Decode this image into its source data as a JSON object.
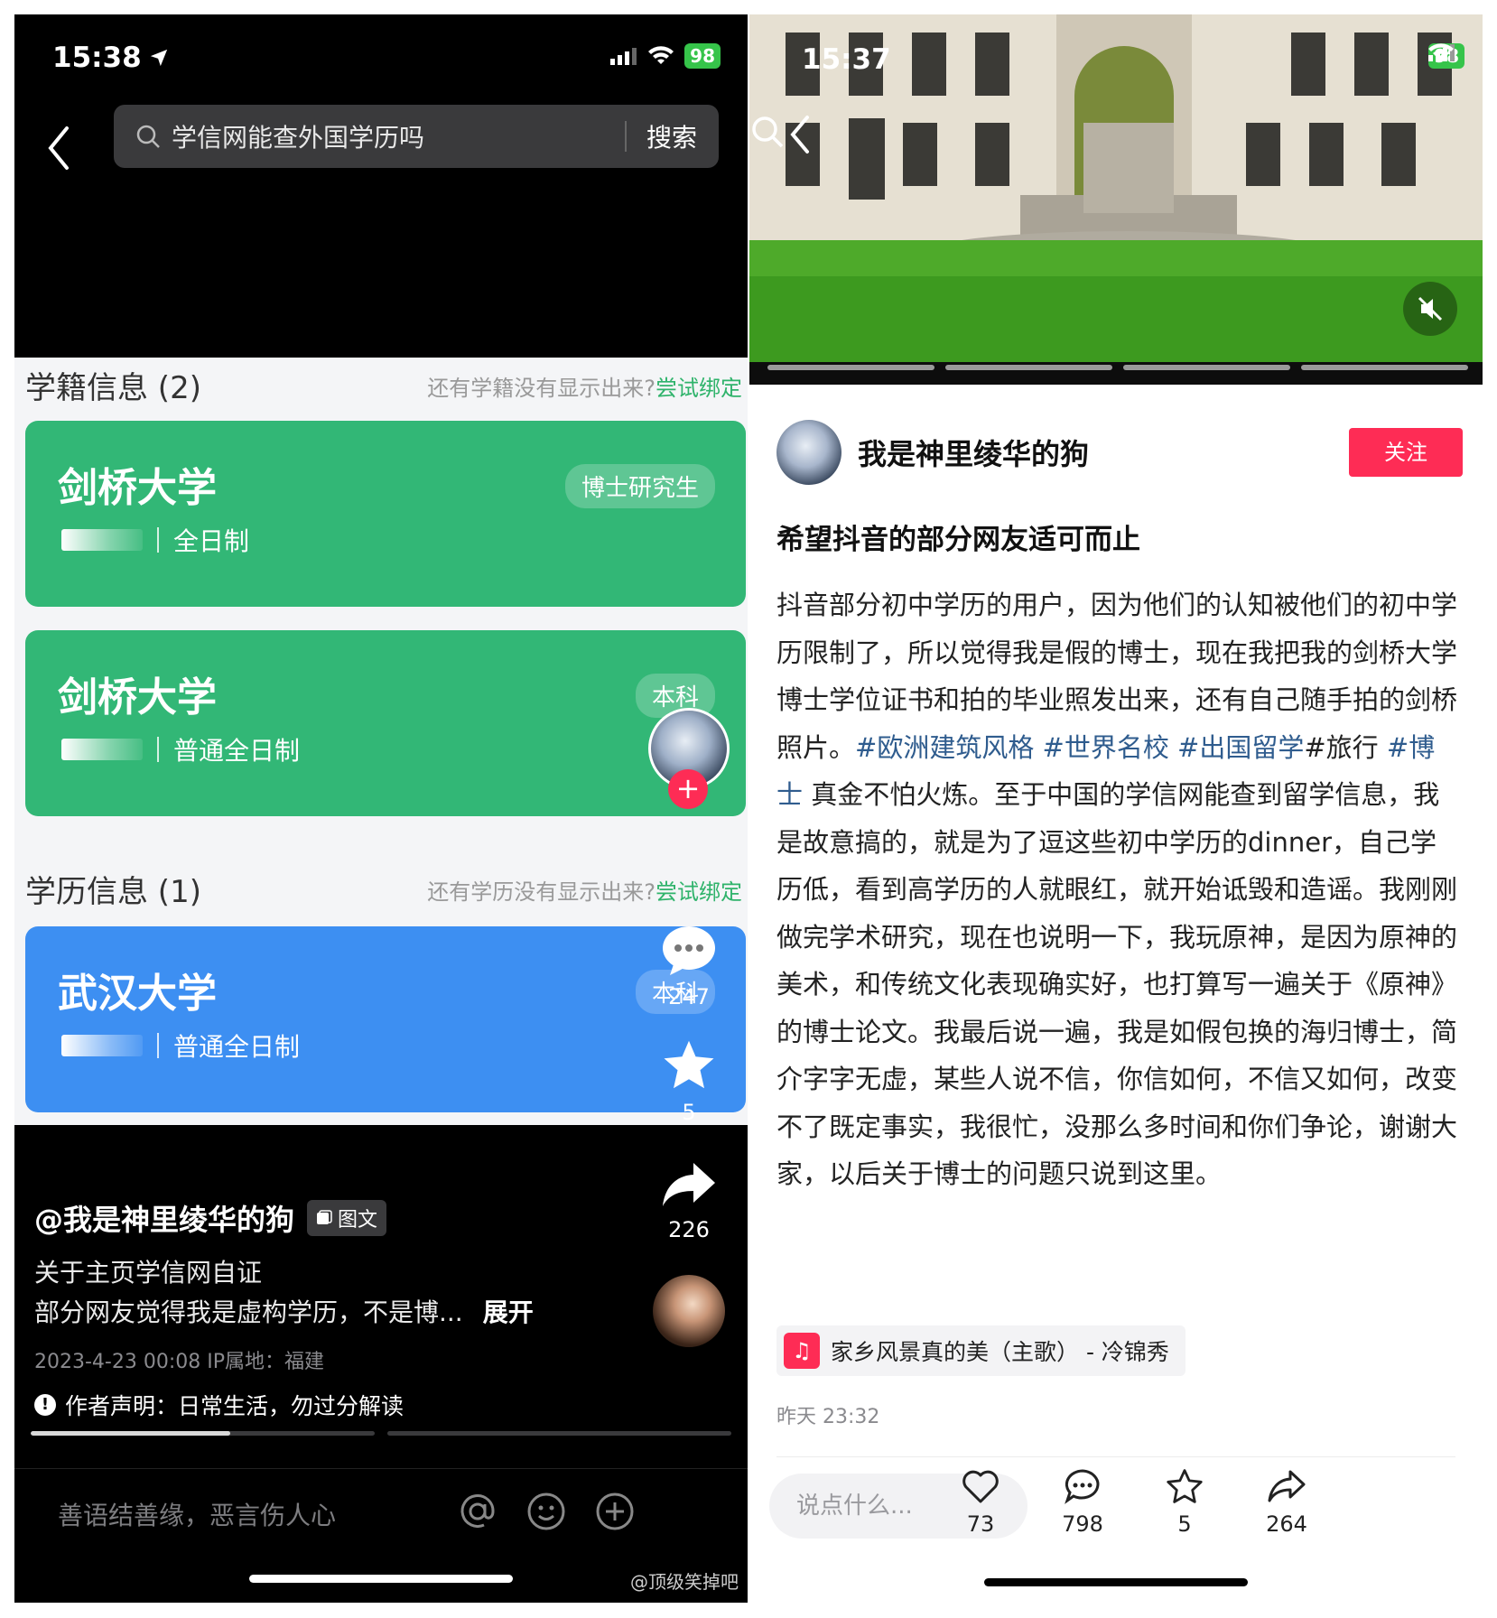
{
  "left": {
    "status": {
      "time": "15:38",
      "battery": "98"
    },
    "search": {
      "query": "学信网能查外国学历吗",
      "button": "搜索"
    },
    "xueji": {
      "title": "学籍信息 (2)",
      "hint": "还有学籍没有显示出来?",
      "hint_link": "尝试绑定",
      "cards": [
        {
          "school": "剑桥大学",
          "level": "博士研究生",
          "mode": "全日制"
        },
        {
          "school": "剑桥大学",
          "level": "本科",
          "mode": "普通全日制"
        }
      ]
    },
    "xueli": {
      "title": "学历信息 (1)",
      "hint": "还有学历没有显示出来?",
      "hint_link": "尝试绑定",
      "cards": [
        {
          "school": "武汉大学",
          "level": "本科",
          "mode": "普通全日制"
        }
      ]
    },
    "actions": {
      "comments": "247",
      "favorites": "5",
      "shares": "226"
    },
    "post": {
      "handle": "@我是神里绫华的狗",
      "type_pill": "图文",
      "line1": "关于主页学信网自证",
      "line2": "部分网友觉得我是虚构学历，不是博...",
      "expand": "展开",
      "meta": "2023-4-23 00:08  IP属地：福建",
      "declaration": "作者声明：日常生活，勿过分解读",
      "progress": 0.58
    },
    "comment_placeholder": "善语结善缘，恶言伤人心",
    "watermark": "@顶级笑掉吧"
  },
  "right": {
    "status": {
      "time": "15:37",
      "battery": "98"
    },
    "author": "我是神里绫华的狗",
    "follow": "关注",
    "title": "希望抖音的部分网友适可而止",
    "body_parts": [
      {
        "t": "抖音部分初中学历的用户，因为他们的认知被他们的初中学历限制了，所以觉得我是假的博士，现在我把我的剑桥大学博士学位证书和拍的毕业照发出来，还有自己随手拍的剑桥照片。"
      },
      {
        "t": "#欧洲建筑风格 #世界名校 #出国留学",
        "tag": true
      },
      {
        "t": "#旅行 "
      },
      {
        "t": "#博士",
        "tag": true
      },
      {
        "t": " 真金不怕火炼。至于中国的学信网能查到留学信息，我是故意搞的，就是为了逗这些初中学历的dinner，自己学历低，看到高学历的人就眼红，就开始诋毁和造谣。我刚刚做完学术研究，现在也说明一下，我玩原神，是因为原神的美术，和传统文化表现确实好，也打算写一遍关于《原神》的博士论文。我最后说一遍，我是如假包换的海归博士，简介字字无虚，某些人说不信，你信如何，不信又如何，改变不了既定事实，我很忙，没那么多时间和你们争论，谢谢大家，以后关于博士的问题只说到这里。"
      }
    ],
    "music": "家乡风景真的美（主歌） - 冷锦秀",
    "date": "昨天 23:32",
    "say_placeholder": "说点什么...",
    "stats": {
      "likes": "73",
      "comments": "798",
      "favorites": "5",
      "shares": "264"
    }
  }
}
